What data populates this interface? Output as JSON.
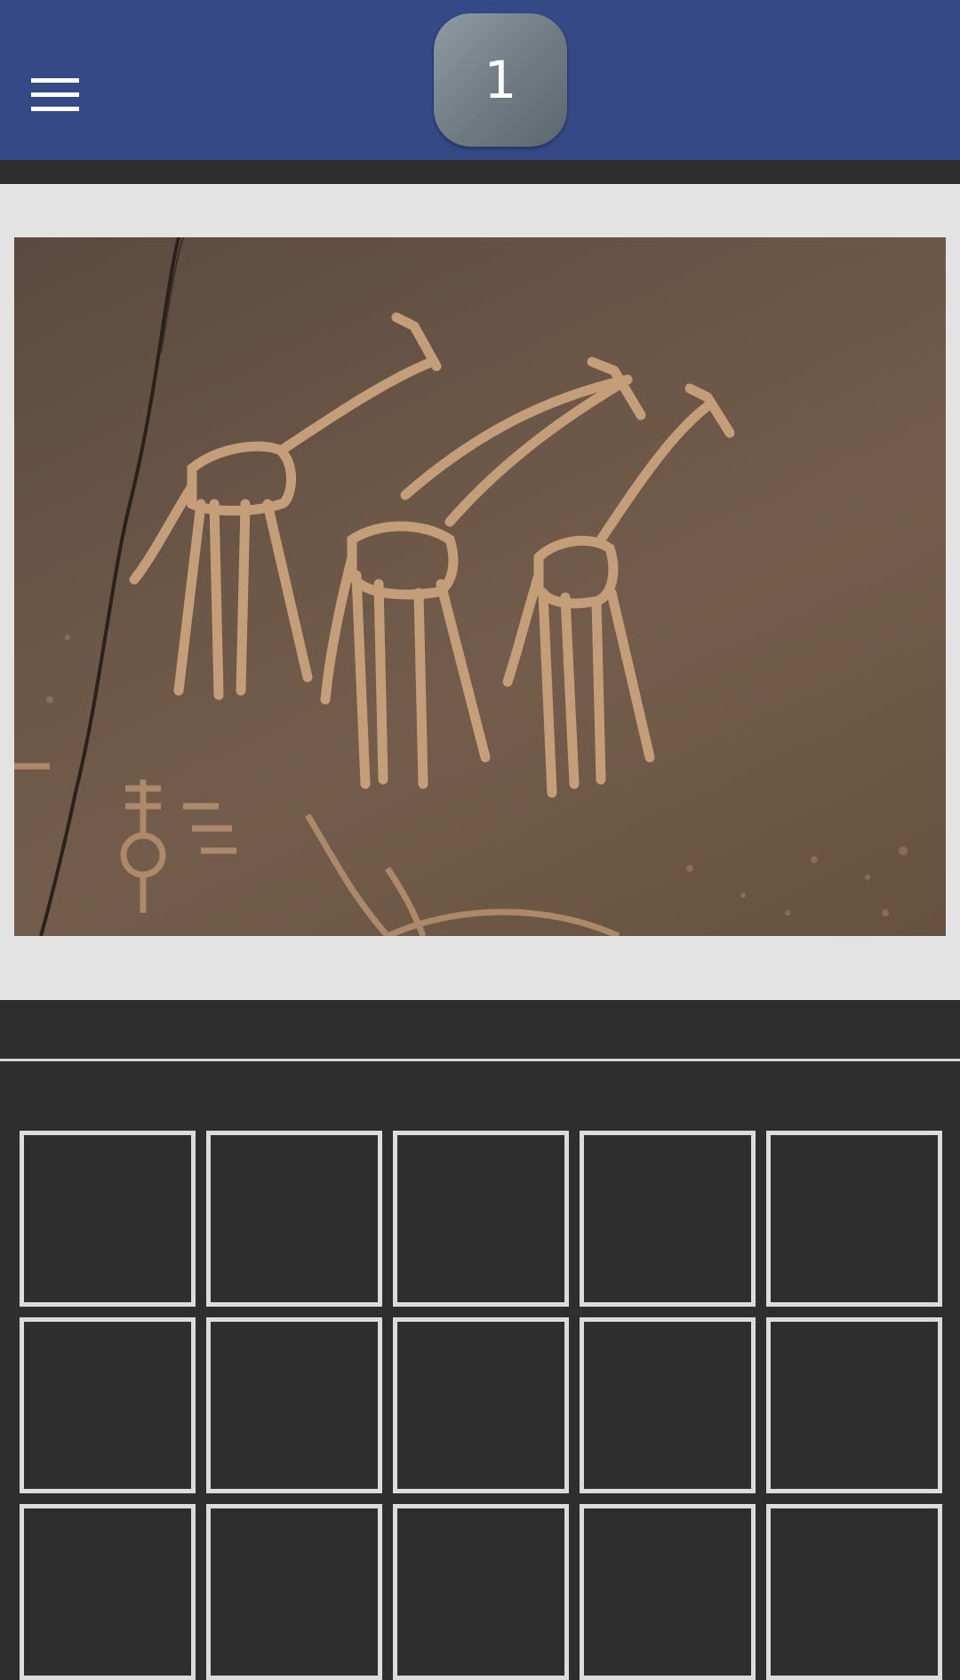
{
  "app_bar": {
    "menu_icon": "hamburger-menu-icon",
    "level_number": "1",
    "background_color": "#344985"
  },
  "puzzle": {
    "image_subject": "rock-engraving-giraffes"
  },
  "answer_grid": {
    "columns": 5,
    "tiles": [
      "",
      "",
      "",
      "",
      "",
      "",
      "",
      "",
      "",
      "",
      "",
      "",
      "",
      "",
      ""
    ]
  }
}
